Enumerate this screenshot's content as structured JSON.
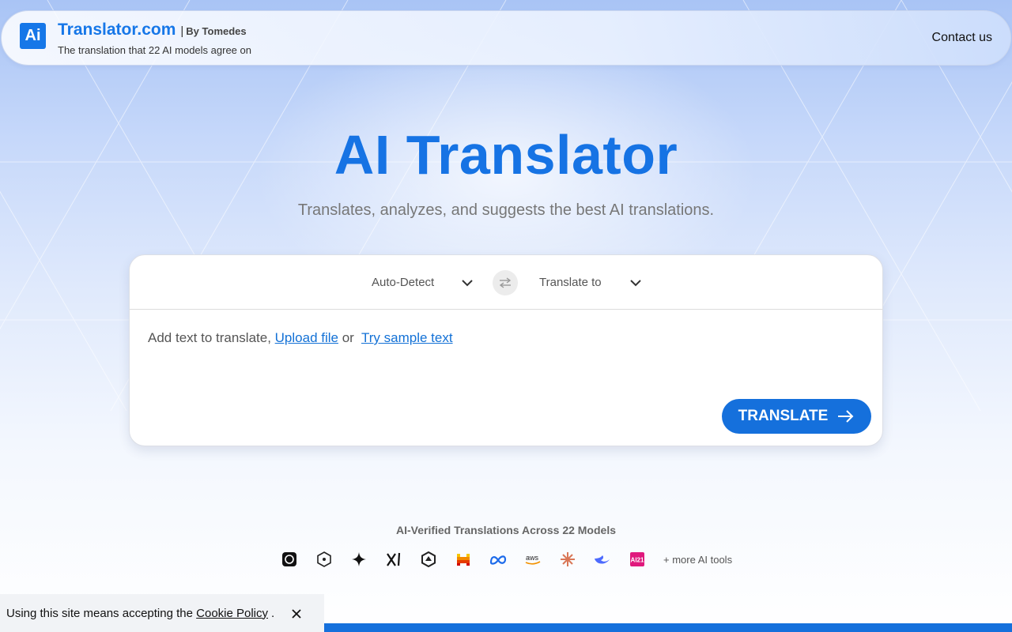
{
  "header": {
    "logo_text": "Ai",
    "brand_name": "Translator.com",
    "brand_separator": "|",
    "brand_by": "By Tomedes",
    "tagline": "The translation that 22 AI models agree on",
    "contact_label": "Contact us"
  },
  "hero": {
    "title": "AI Translator",
    "subtitle": "Translates, analyzes, and suggests the best AI translations."
  },
  "translator": {
    "source_language": "Auto-Detect",
    "target_language": "Translate to",
    "input_prompt": "Add text to translate,",
    "upload_label": "Upload file",
    "or_text": "or",
    "sample_label": "Try sample text",
    "translate_label": "TRANSLATE"
  },
  "models": {
    "title": "AI-Verified Translations Across 22 Models",
    "icons": [
      "openai-icon",
      "deepl-icon",
      "gemini-icon",
      "grok-icon",
      "qwen-icon",
      "mistral-icon",
      "meta-icon",
      "aws-icon",
      "claude-icon",
      "deepseek-icon",
      "ai21-icon"
    ],
    "aws_text": "aws",
    "ai21_text": "AI21",
    "more_label": "+ more AI tools"
  },
  "cookie": {
    "text": "Using this site means accepting the",
    "link_label": "Cookie Policy",
    "suffix": "."
  },
  "colors": {
    "accent": "#1570dc",
    "brand": "#1677e8"
  }
}
